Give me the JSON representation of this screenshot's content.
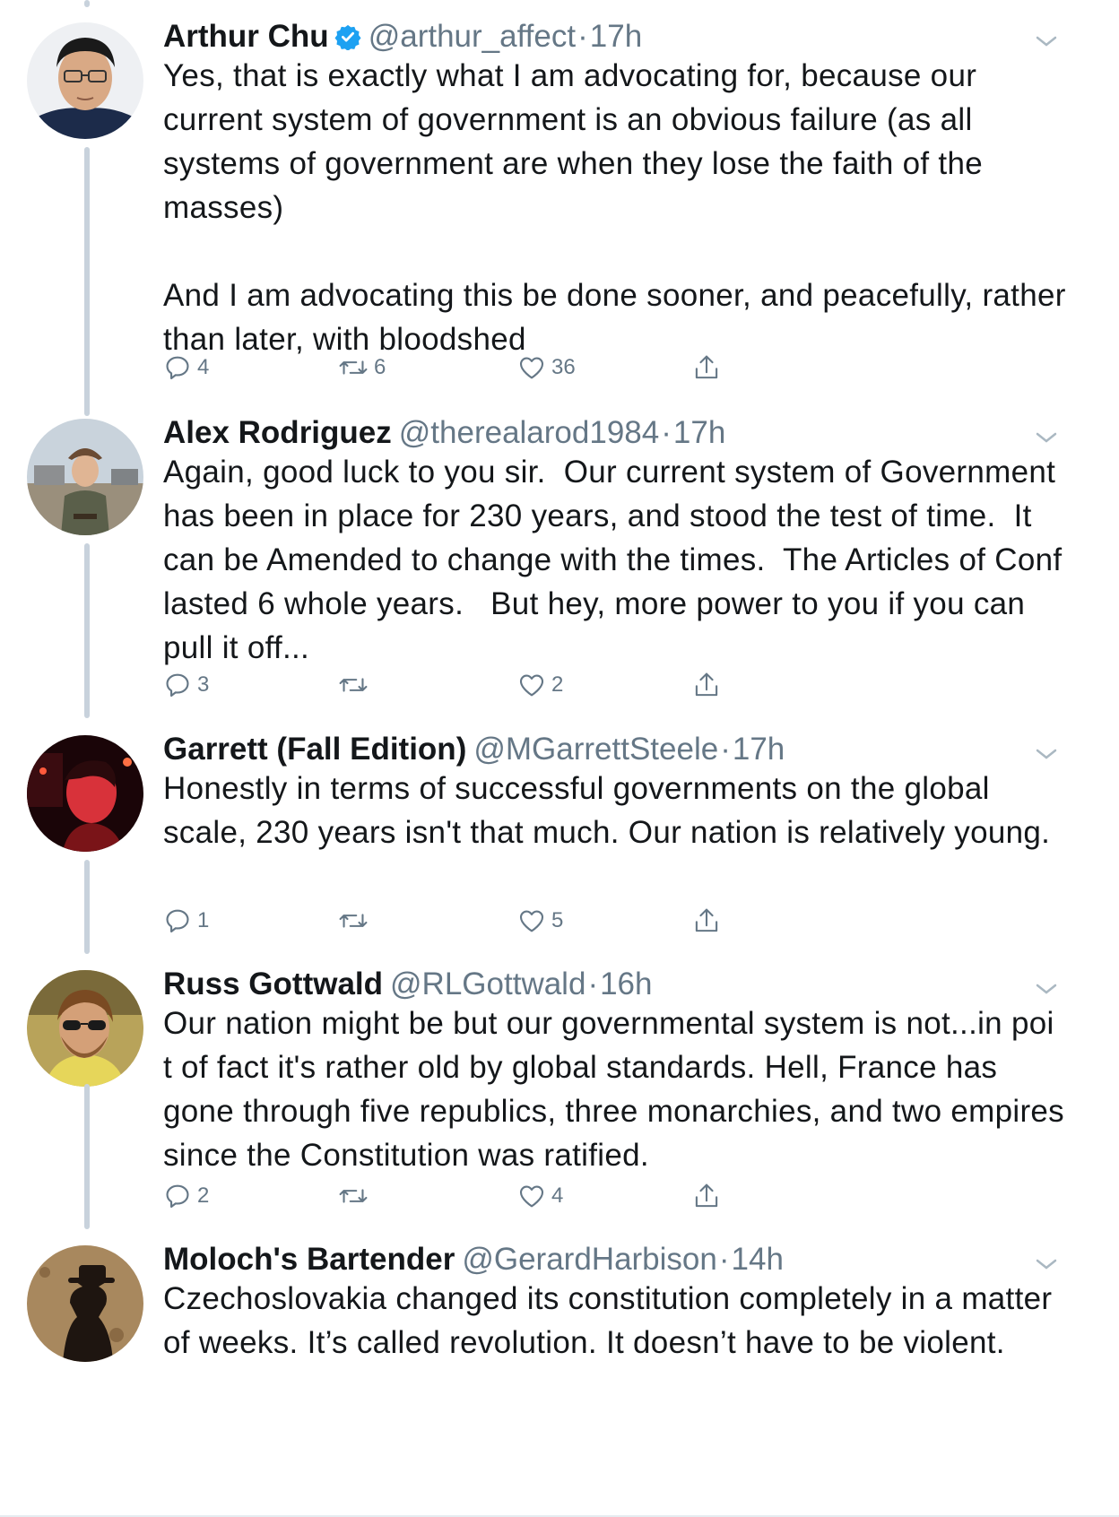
{
  "tweets": [
    {
      "name": "Arthur Chu",
      "verified": true,
      "handle": "@arthur_affect",
      "separator": "·",
      "time": "17h",
      "text": "Yes, that is exactly what I am advocating for, because our current system of government is an obvious failure (as all systems of government are when they lose the faith of the masses)\n\nAnd I am advocating this be done sooner, and peacefully, rather than later, with bloodshed",
      "replies": "4",
      "retweets": "6",
      "likes": "36"
    },
    {
      "name": "Alex Rodriguez",
      "verified": false,
      "handle": "@therealarod1984",
      "separator": "·",
      "time": "17h",
      "text": "Again, good luck to you sir.  Our current system of Government has been in place for 230 years, and stood the test of time.  It can be Amended to change with the times.  The Articles of Conf lasted 6 whole years.   But hey, more power to you if you can pull it off...",
      "replies": "3",
      "retweets": "",
      "likes": "2"
    },
    {
      "name": "Garrett (Fall Edition)",
      "verified": false,
      "handle": "@MGarrettSteele",
      "separator": "·",
      "time": "17h",
      "text": "Honestly in terms of successful governments on the global scale, 230 years isn't that much. Our nation is relatively young.",
      "replies": "1",
      "retweets": "",
      "likes": "5"
    },
    {
      "name": "Russ Gottwald",
      "verified": false,
      "handle": "@RLGottwald",
      "separator": "·",
      "time": "16h",
      "text": "Our nation might be but our governmental system is not...in poi t of fact it's rather old by global standards. Hell, France has gone through five republics, three monarchies, and two empires since the Constitution was ratified.",
      "replies": "2",
      "retweets": "",
      "likes": "4"
    },
    {
      "name": "Moloch's Bartender",
      "verified": false,
      "handle": "@GerardHarbison",
      "separator": "·",
      "time": "14h",
      "text": "Czechoslovakia changed its constitution completely in a matter of weeks. It’s called revolution. It doesn’t have to be violent."
    }
  ],
  "icons": {
    "reply": "reply-icon",
    "retweet": "retweet-icon",
    "like": "heart-icon",
    "share": "share-icon",
    "caret": "chevron-down-icon",
    "verified": "verified-badge-icon"
  },
  "colors": {
    "text": "#14171a",
    "secondary": "#657786",
    "verified_blue": "#1da1f2",
    "thread_line": "#c8d2dc"
  }
}
